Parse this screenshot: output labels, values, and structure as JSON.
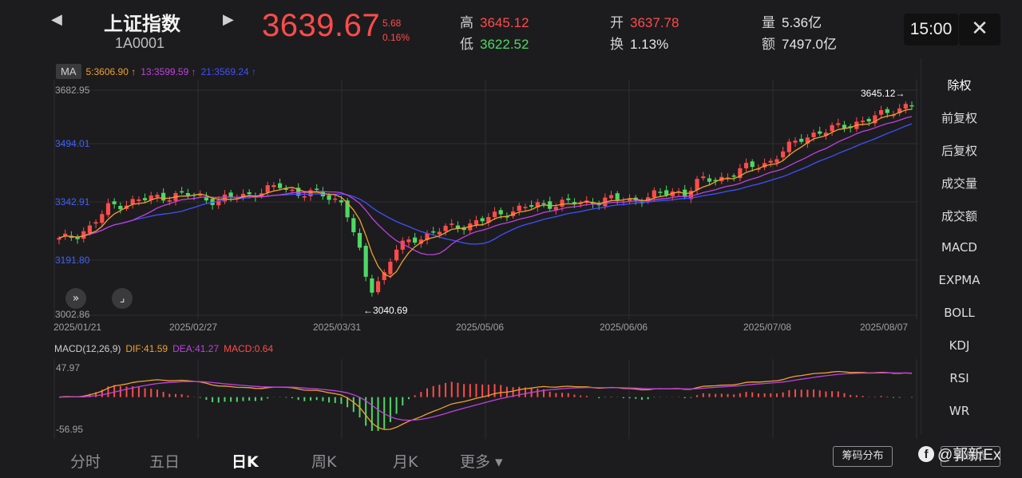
{
  "header": {
    "prev_icon": "triangle-left-icon",
    "next_icon": "triangle-right-icon",
    "name": "上证指数",
    "code": "1A0001",
    "price": "3639.67",
    "change": "5.68",
    "change_pct": "0.16%",
    "high_label": "高",
    "high": "3645.12",
    "low_label": "低",
    "low": "3622.52",
    "open_label": "开",
    "open": "3637.78",
    "turnover_label": "换",
    "turnover": "1.13%",
    "volume_label": "量",
    "volume": "5.36亿",
    "amount_label": "额",
    "amount": "7497.0亿",
    "time": "15:00",
    "close_icon": "close-icon"
  },
  "ma_bar": {
    "button": "MA",
    "ma5": "5:3606.90 ↑",
    "ma13": "13:3599.59 ↑",
    "ma21": "21:3569.24 ↑"
  },
  "macd_bar": {
    "title": "MACD(12,26,9)",
    "dif": "DIF:41.59",
    "dea": "DEA:41.27",
    "macd": "MACD:0.64"
  },
  "chart_data": {
    "type": "candlestick",
    "y_ticks": [
      "3682.95",
      "3494.01",
      "3342.91",
      "3191.80",
      "3002.86"
    ],
    "x_ticks": [
      "2025/01/21",
      "2025/02/27",
      "2025/03/31",
      "2025/05/06",
      "2025/06/06",
      "2025/07/08",
      "2025/08/07"
    ],
    "ylim": [
      3002.86,
      3682.95
    ],
    "annotations": {
      "high_marker": "3645.12→",
      "low_marker": "←3040.69"
    },
    "macd_ticks": [
      "47.97",
      "-56.95"
    ],
    "macd_ylim": [
      -56.95,
      47.97
    ],
    "colors": {
      "up": "#ff4b4b",
      "down": "#4cd964",
      "ma5": "#f0a030",
      "ma13": "#c040e0",
      "ma21": "#4050ff"
    }
  },
  "buttons": {
    "expand_icon": "double-chevron-right-icon",
    "crosshair_icon": "crosshair-icon"
  },
  "side_menu": [
    "除权",
    "前复权",
    "后复权",
    "成交量",
    "成交额",
    "MACD",
    "EXPMA",
    "BOLL",
    "KDJ",
    "RSI",
    "WR"
  ],
  "tabs": [
    "分时",
    "五日",
    "日K",
    "周K",
    "月K",
    "更多 ▾"
  ],
  "chips": {
    "chip_dist": "筹码分布",
    "hidden": "编自选"
  },
  "watermark": {
    "icon": "facebook-icon",
    "text": "@郭新Ex"
  }
}
